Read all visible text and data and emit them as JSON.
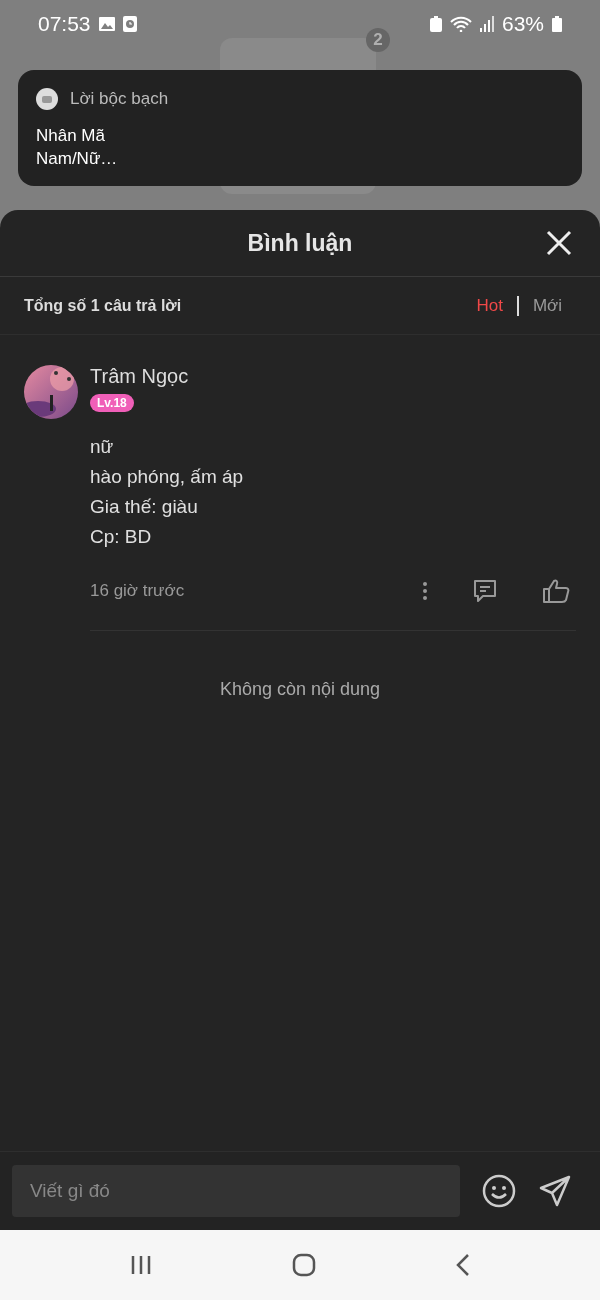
{
  "status_bar": {
    "time": "07:53",
    "battery": "63%"
  },
  "background": {
    "badge": "2"
  },
  "notification": {
    "app": "Lời bộc bạch",
    "lines": [
      "Nhân Mã",
      "Nam/Nữ…"
    ]
  },
  "sheet": {
    "title": "Bình luận",
    "total": "Tổng số 1 câu trả lời",
    "sort_tabs": [
      {
        "label": "Hot",
        "selected": true
      },
      {
        "label": "Mới",
        "selected": false
      }
    ]
  },
  "comments": [
    {
      "author": "Trâm Ngọc",
      "level": "Lv.18",
      "lines": [
        "nữ",
        "hào phóng, ấm áp",
        "Gia thế: giàu",
        "Cp: BD"
      ],
      "time": "16 giờ trước"
    }
  ],
  "end_text": "Không còn nội dung",
  "input": {
    "placeholder": "Viết gì đó"
  }
}
